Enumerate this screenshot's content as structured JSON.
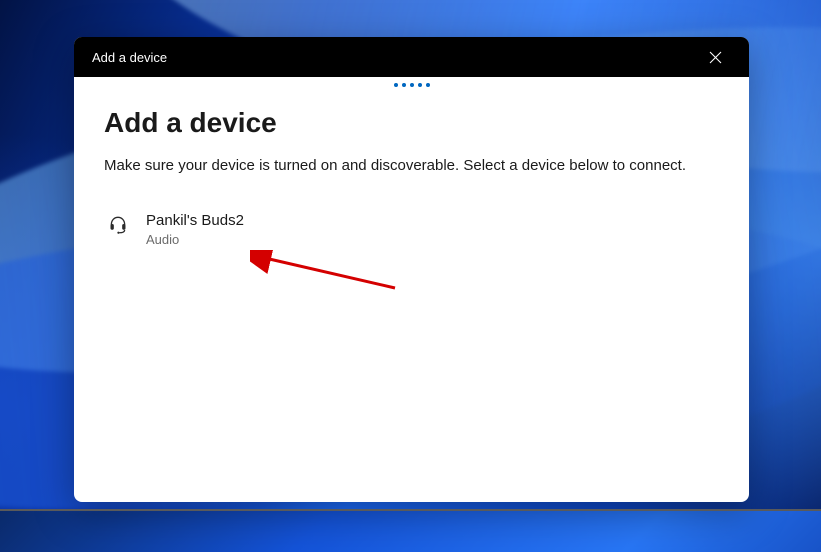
{
  "titlebar": {
    "title": "Add a device"
  },
  "dialog": {
    "heading": "Add a device",
    "description": "Make sure your device is turned on and discoverable. Select a device below to connect."
  },
  "devices": [
    {
      "name": "Pankil's Buds2",
      "type": "Audio",
      "icon": "headset-icon"
    }
  ]
}
